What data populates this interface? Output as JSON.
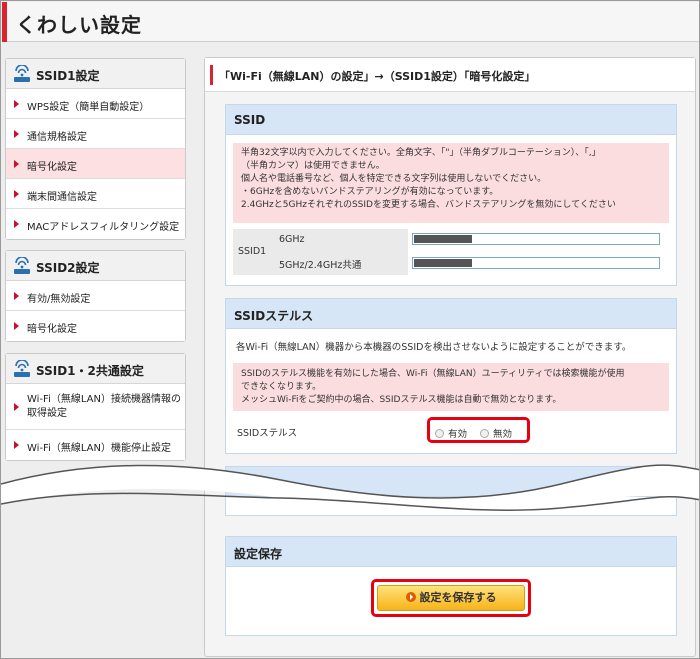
{
  "page": {
    "title": "くわしい設定"
  },
  "sidebar": {
    "groups": [
      {
        "title": "SSID1設定",
        "items": [
          {
            "label": "WPS設定（簡単自動設定）",
            "active": false
          },
          {
            "label": "通信規格設定",
            "active": false
          },
          {
            "label": "暗号化設定",
            "active": true
          },
          {
            "label": "端末間通信設定",
            "active": false
          },
          {
            "label": "MACアドレスフィルタリング設定",
            "active": false
          }
        ]
      },
      {
        "title": "SSID2設定",
        "items": [
          {
            "label": "有効/無効設定",
            "active": false
          },
          {
            "label": "暗号化設定",
            "active": false
          }
        ]
      },
      {
        "title": "SSID1・2共通設定",
        "items": [
          {
            "label": "Wi-Fi（無線LAN）接続機器情報の取得設定",
            "active": false
          },
          {
            "label": "Wi-Fi（無線LAN）機能停止設定",
            "active": false
          }
        ]
      }
    ]
  },
  "main": {
    "title": "「Wi-Fi（無線LAN）の設定」→（SSID1設定）「暗号化設定」",
    "ssid": {
      "heading": "SSID",
      "notes": [
        "半角32文字以内で入力してください。全角文字、「\"」（半角ダブルコーテーション）、「,」",
        "（半角カンマ）は使用できません。",
        "個人名や電話番号など、個人を特定できる文字列は使用しないでください。",
        "・6GHzを含めないバンドステアリングが有効になっています。",
        "2.4GHzと5GHzそれぞれのSSIDを変更する場合、バンドステアリングを無効にしてください"
      ],
      "row_label": "SSID1",
      "band1": "6GHz",
      "band2": "5GHz/2.4GHz共通"
    },
    "stealth": {
      "heading": "SSIDステルス",
      "description": "各Wi-Fi（無線LAN）機器から本機器のSSIDを検出させないように設定することができます。",
      "notes": [
        "SSIDのステルス機能を有効にした場合、Wi-Fi（無線LAN）ユーティリティでは検索機能が使用",
        "できなくなります。",
        "メッシュWi-Fiをご契約中の場合、SSIDステルス機能は自動で無効となります。"
      ],
      "row_label": "SSIDステルス",
      "option_on": "有効",
      "option_off": "無効"
    },
    "save": {
      "heading": "設定保存",
      "button_label": "設定を保存する"
    }
  },
  "colors": {
    "accent_red": "#d9232d",
    "highlight_red": "#e60012",
    "section_blue": "#d6e6f7",
    "note_pink": "#fbdde0",
    "button_orange": "#f6b31a"
  }
}
